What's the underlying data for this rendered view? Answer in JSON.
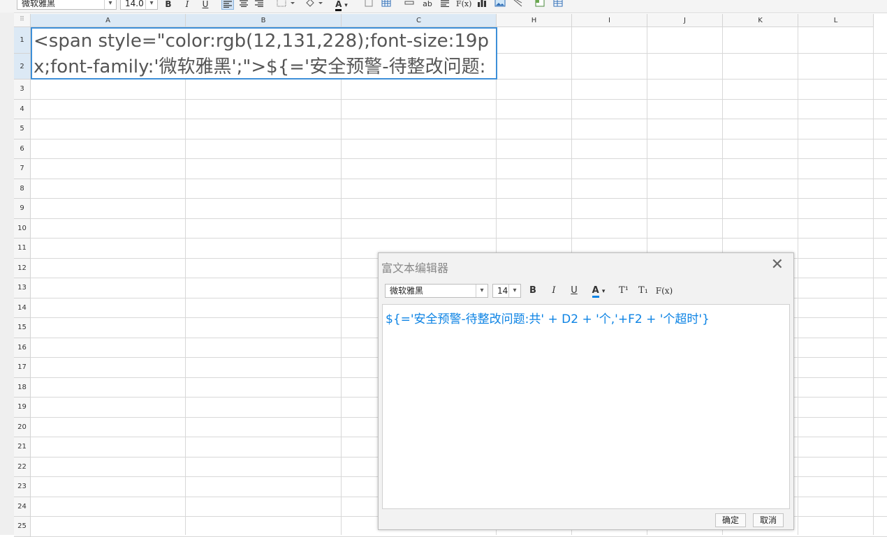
{
  "toolbar": {
    "font_name": "微软雅黑",
    "font_size": "14.0",
    "bold": "B",
    "italic": "I",
    "underline": "U",
    "font_color_label": "A",
    "text_label": "ab",
    "formula_label": "F(x)"
  },
  "sheet": {
    "corner": "⠿",
    "columns": [
      "A",
      "B",
      "C",
      "H",
      "I",
      "J",
      "K",
      "L"
    ],
    "rows": [
      "1",
      "2",
      "3",
      "4",
      "5",
      "6",
      "7",
      "8",
      "9",
      "10",
      "11",
      "12",
      "13",
      "14",
      "15",
      "16",
      "17",
      "18",
      "19",
      "20",
      "21",
      "22",
      "23",
      "24",
      "25"
    ],
    "merged_cell": {
      "line1": "<span style=\"color:rgb(12,131,228);font-size:19p",
      "line2": "x;font-family:'微软雅黑';\">${='安全预警-待整改问题:"
    }
  },
  "dialog": {
    "title": "富文本编辑器",
    "font_name": "微软雅黑",
    "font_size": "14",
    "bold": "B",
    "italic": "I",
    "underline": "U",
    "font_color_label": "A",
    "superscript": "T¹",
    "subscript": "T₁",
    "formula": "F(x)",
    "content": "${='安全预警-待整改问题:共' + D2 + '个,'+F2 + '个超时'}",
    "ok_label": "确定",
    "cancel_label": "取消",
    "content_color": "#0c83e4"
  }
}
